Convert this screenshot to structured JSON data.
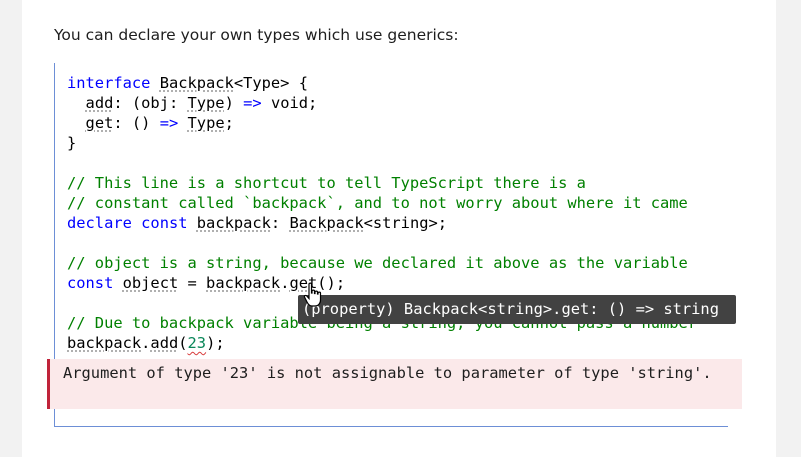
{
  "intro_text": "You can declare your own types which use generics:",
  "code": {
    "l1_kw": "interface",
    "l1_name": "Backpack",
    "l1_rest": "<Type> {",
    "l2_prop": "add",
    "l2_mid": ": (obj: ",
    "l2_type": "Type",
    "l2_arrow": "=>",
    "l2_end": " void;",
    "l3_prop": "get",
    "l3_mid": ": () ",
    "l3_arrow": "=>",
    "l3_type": "Type",
    "l3_end": ";",
    "l4": "}",
    "c1": "// This line is a shortcut to tell TypeScript there is a",
    "c2": "// constant called `backpack`, and to not worry about where it came",
    "l7_kw1": "declare",
    "l7_kw2": "const",
    "l7_var": "backpack",
    "l7_colon": ": ",
    "l7_type": "Backpack",
    "l7_end": "<string>;",
    "c3": "// object is a string, because we declared it above as the variable",
    "l9_kw": "const",
    "l9_var": "object",
    "l9_eq": " = ",
    "l9_obj": "backpack",
    "l9_dot": ".",
    "l9_get": "get",
    "l9_end": "();",
    "c4": "// Due to backpack variable being a string, you cannot pass a number",
    "l11_obj": "backpack",
    "l11_dot": ".",
    "l11_add": "add",
    "l11_open": "(",
    "l11_num": "23",
    "l11_end": ");"
  },
  "tooltip_text": "(property) Backpack<string>.get: () => string",
  "error_text": "Argument of type '23' is not assignable to parameter of type 'string'.",
  "colors": {
    "keyword": "#0000ff",
    "comment": "#008000",
    "number": "#098658",
    "error_border": "#c0233a",
    "tooltip_bg": "#424242"
  }
}
